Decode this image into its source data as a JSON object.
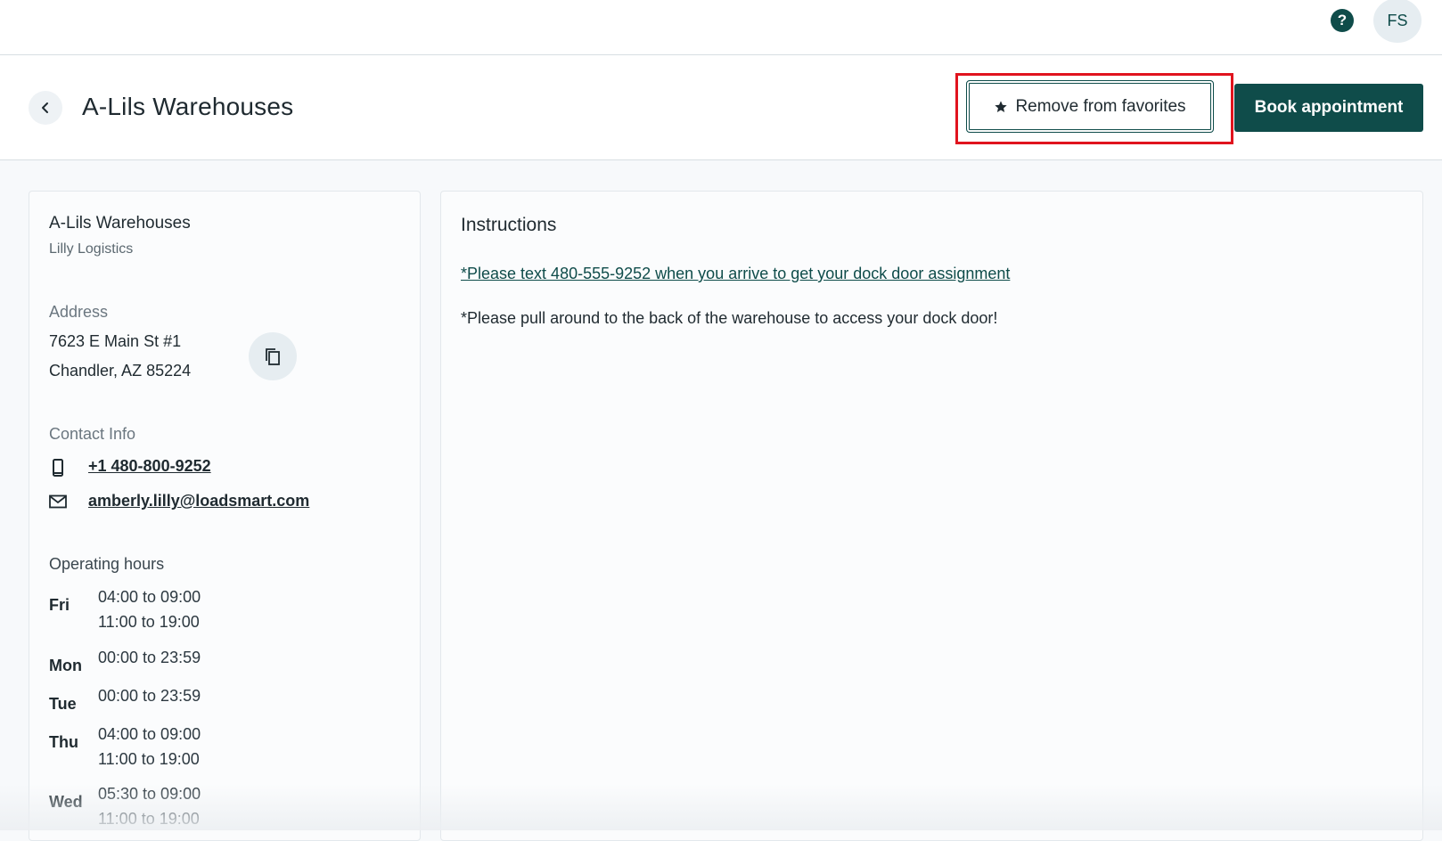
{
  "topbar": {
    "help_icon": "question-circle-icon",
    "help_glyph": "?",
    "avatar_initials": "FS"
  },
  "header": {
    "back_icon": "chevron-left-icon",
    "title": "A-Lils Warehouses",
    "favorite_label": "Remove from favorites",
    "favorite_icon": "star-icon",
    "book_label": "Book appointment"
  },
  "details": {
    "name": "A-Lils Warehouses",
    "company": "Lilly Logistics",
    "address_label": "Address",
    "address_line1": "7623 E Main St #1",
    "address_line2": "Chandler, AZ 85224",
    "contact_label": "Contact Info",
    "phone": "+1 480-800-9252",
    "email": "amberly.lilly@loadsmart.com",
    "hours_label": "Operating hours",
    "hours": [
      {
        "day": "Fri",
        "slots": [
          "04:00 to 09:00",
          "11:00 to 19:00"
        ]
      },
      {
        "day": "Mon",
        "slots": [
          "00:00 to 23:59"
        ]
      },
      {
        "day": "Tue",
        "slots": [
          "00:00 to 23:59"
        ]
      },
      {
        "day": "Thu",
        "slots": [
          "04:00 to 09:00",
          "11:00 to 19:00"
        ]
      },
      {
        "day": "Wed",
        "slots": [
          "05:30 to 09:00",
          "11:00 to 19:00"
        ]
      }
    ]
  },
  "instructions": {
    "title": "Instructions",
    "link_text": "*Please text 480-555-9252 when you arrive to get your dock door assignment",
    "note": "*Please pull around to the back of the warehouse to access your dock door!"
  },
  "colors": {
    "brand": "#0f4c4a",
    "highlight": "#e0141e"
  }
}
